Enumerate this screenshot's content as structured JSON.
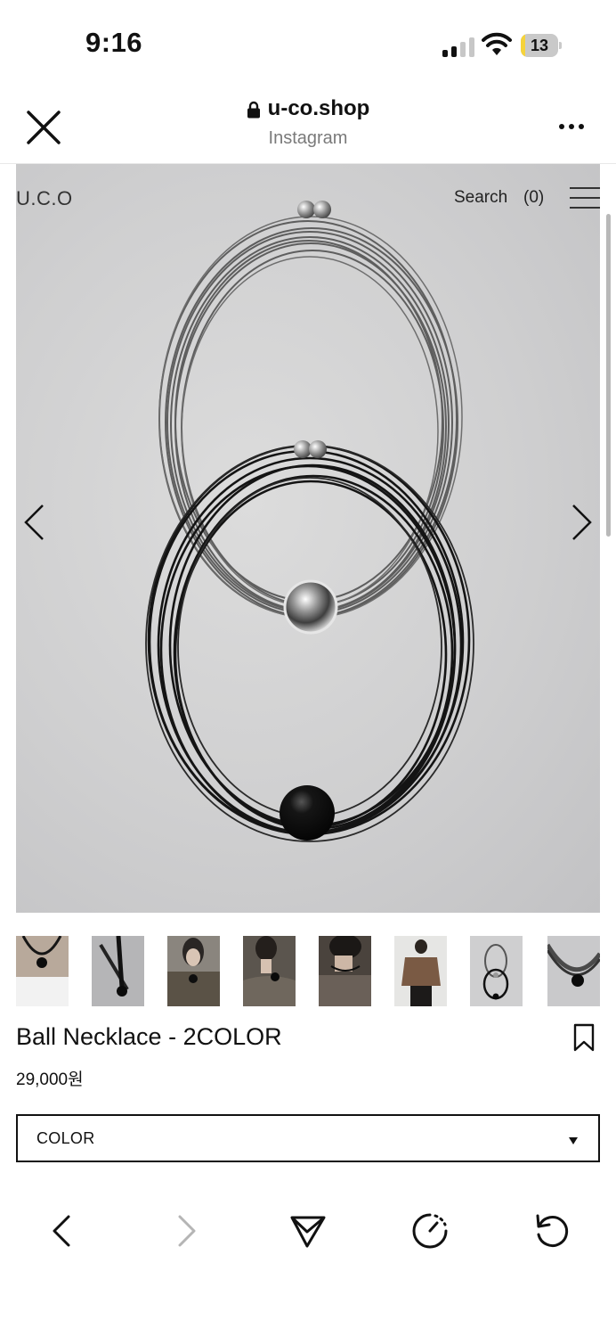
{
  "status_bar": {
    "time": "9:16",
    "battery_level": "13",
    "battery_fraction": 0.13,
    "signal_bars_active": 2,
    "icons": [
      "cellular-signal-icon",
      "wifi-icon",
      "battery-icon"
    ]
  },
  "browser": {
    "domain": "u-co.shop",
    "source_app": "Instagram",
    "icons": [
      "close-icon",
      "lock-icon",
      "more-icon"
    ]
  },
  "site_header": {
    "logo": "U.C.O",
    "search_label": "Search",
    "cart_count": "(0)",
    "icons": [
      "menu-icon"
    ]
  },
  "gallery": {
    "icons": [
      "chevron-left-icon",
      "chevron-right-icon"
    ],
    "thumbnail_count": 8
  },
  "product": {
    "name": "Ball Necklace - 2COLOR",
    "price": "29,000원",
    "option_placeholder": "COLOR",
    "icons": [
      "bookmark-icon",
      "caret-down-icon"
    ]
  },
  "bottom_nav": {
    "icons": [
      "back-icon",
      "forward-icon",
      "share-icon",
      "timer-icon",
      "reload-icon"
    ],
    "forward_enabled": false
  },
  "colors": {
    "text": "#111111",
    "muted": "#7a7a7a",
    "battery_fill": "#f5d33b",
    "disabled": "#b5b5b5"
  }
}
